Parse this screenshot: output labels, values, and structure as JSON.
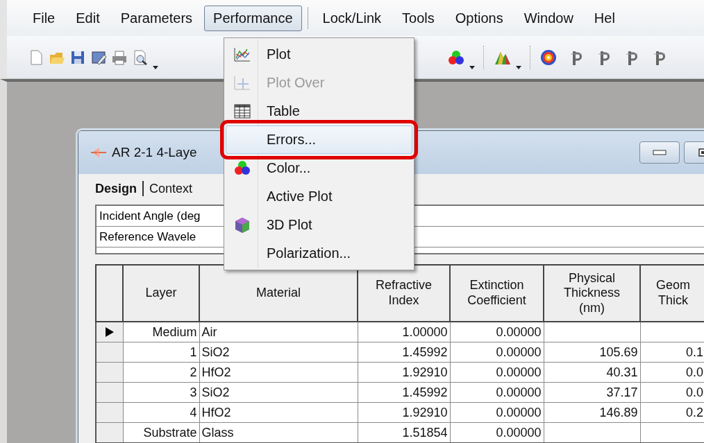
{
  "menu_bar": [
    {
      "label": "File",
      "selected": false
    },
    {
      "label": "Edit",
      "selected": false
    },
    {
      "label": "Parameters",
      "selected": false
    },
    {
      "label": "Performance",
      "selected": true
    },
    {
      "label": "Lock/Link",
      "selected": false
    },
    {
      "label": "Tools",
      "selected": false
    },
    {
      "label": "Options",
      "selected": false
    },
    {
      "label": "Window",
      "selected": false
    },
    {
      "label": "Hel",
      "selected": false
    }
  ],
  "performance_menu": [
    {
      "label": "Plot",
      "kind": "plot",
      "disabled": false,
      "selected": false,
      "callout": false
    },
    {
      "label": "Plot Over",
      "kind": "plotover",
      "disabled": true,
      "selected": false,
      "callout": false
    },
    {
      "label": "Table",
      "kind": "table",
      "disabled": false,
      "selected": false,
      "callout": false
    },
    {
      "label": "Errors...",
      "kind": "plain",
      "disabled": false,
      "selected": true,
      "callout": true
    },
    {
      "label": "Color...",
      "kind": "color",
      "disabled": false,
      "selected": false,
      "callout": false
    },
    {
      "label": "Active Plot",
      "kind": "plain",
      "disabled": false,
      "selected": false,
      "callout": false
    },
    {
      "label": "3D Plot",
      "kind": "cube",
      "disabled": false,
      "selected": false,
      "callout": false
    },
    {
      "label": "Polarization...",
      "kind": "plain",
      "disabled": false,
      "selected": false,
      "callout": false
    }
  ],
  "document_window": {
    "title": "AR 2-1 4-Laye",
    "tabs": [
      {
        "label": "Design",
        "selected": true
      },
      {
        "label": "Context",
        "selected": false
      }
    ],
    "fields": [
      "Incident Angle (deg",
      "Reference Wavele"
    ],
    "table": {
      "columns": [
        "Layer",
        "Material",
        "Refractive\nIndex",
        "Extinction\nCoefficient",
        "Physical\nThickness\n(nm)",
        "Geom\nThick"
      ],
      "rows": [
        {
          "current": true,
          "cells": [
            "Medium",
            "Air",
            "1.00000",
            "0.00000",
            "",
            ""
          ]
        },
        {
          "current": false,
          "cells": [
            "1",
            "SiO2",
            "1.45992",
            "0.00000",
            "105.69",
            "0.1"
          ]
        },
        {
          "current": false,
          "cells": [
            "2",
            "HfO2",
            "1.92910",
            "0.00000",
            "40.31",
            "0.0"
          ]
        },
        {
          "current": false,
          "cells": [
            "3",
            "SiO2",
            "1.45992",
            "0.00000",
            "37.17",
            "0.0"
          ]
        },
        {
          "current": false,
          "cells": [
            "4",
            "HfO2",
            "1.92910",
            "0.00000",
            "146.89",
            "0.2"
          ]
        },
        {
          "current": false,
          "cells": [
            "Substrate",
            "Glass",
            "1.51854",
            "0.00000",
            "",
            ""
          ]
        }
      ]
    }
  }
}
